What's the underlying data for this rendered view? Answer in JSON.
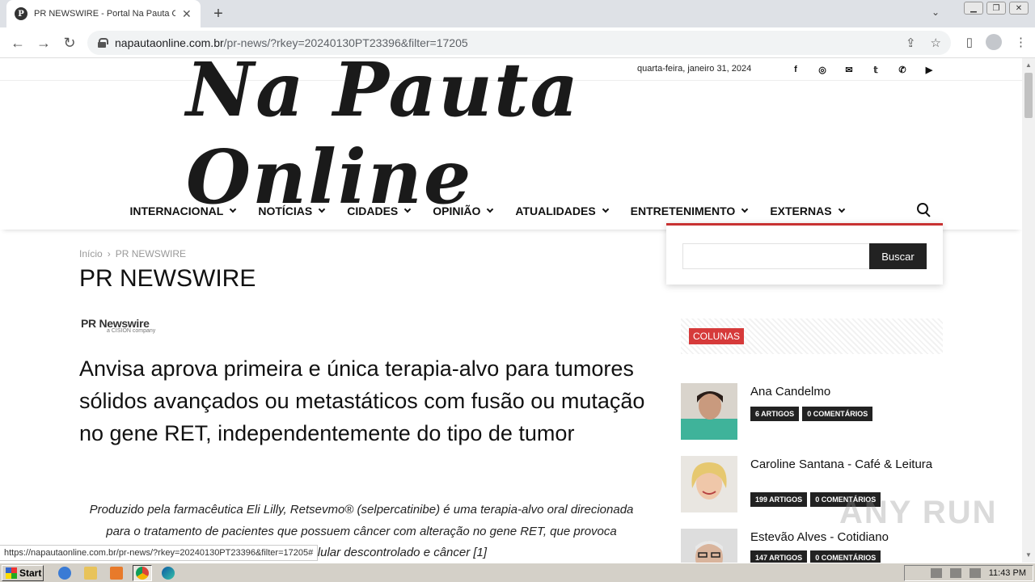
{
  "browser": {
    "tab_title": "PR NEWSWIRE - Portal Na Pauta Online",
    "tab_favicon": "P",
    "new_tab": "+",
    "url_domain": "napautaonline.com.br",
    "url_path": "/pr-news/?rkey=20240130PT23396&filter=17205",
    "status_url": "https://napautaonline.com.br/pr-news/?rkey=20240130PT23396&filter=17205#"
  },
  "site": {
    "date": "quarta-feira, janeiro 31, 2024",
    "logo_text": "Na Pauta Online",
    "social": [
      "facebook-icon",
      "instagram-icon",
      "mail-icon",
      "twitter-icon",
      "whatsapp-icon",
      "youtube-icon"
    ],
    "nav": [
      {
        "label": "INTERNACIONAL"
      },
      {
        "label": "NOTÍCIAS"
      },
      {
        "label": "CIDADES"
      },
      {
        "label": "OPINIÃO"
      },
      {
        "label": "ATUALIDADES"
      },
      {
        "label": "ENTRETENIMENTO"
      },
      {
        "label": "EXTERNAS"
      }
    ],
    "search": {
      "placeholder": "",
      "button": "Buscar"
    }
  },
  "main": {
    "breadcrumb_home": "Início",
    "breadcrumb_sep": "›",
    "breadcrumb_current": "PR NEWSWIRE",
    "page_title": "PR NEWSWIRE",
    "prn_logo": "PR Newswire",
    "prn_sub": "a CISION company",
    "headline": "Anvisa aprova primeira e única terapia-alvo para tumores sólidos avançados ou metastáticos com fusão ou mutação no gene RET, independentemente do tipo de tumor",
    "lead": "Produzido pela farmacêutica Eli Lilly, Retsevmo® (selpercatinibe) é uma terapia-alvo oral direcionada para o tratamento de pacientes que possuem câncer com alteração no gene RET, que provoca crescimento celular descontrolado e câncer [1]"
  },
  "sidebar": {
    "header": "COLUNAS",
    "authors": [
      {
        "name": "Ana Candelmo",
        "articles": "6 ARTIGOS",
        "comments": "0 COMENTÁRIOS"
      },
      {
        "name": "Caroline Santana - Café & Leitura",
        "articles": "199 ARTIGOS",
        "comments": "0 COMENTÁRIOS"
      },
      {
        "name": "Estevão Alves - Cotidiano",
        "articles": "147 ARTIGOS",
        "comments": "0 COMENTÁRIOS"
      }
    ]
  },
  "watermark": "ANY RUN",
  "taskbar": {
    "start": "Start",
    "clock": "11:43 PM"
  }
}
